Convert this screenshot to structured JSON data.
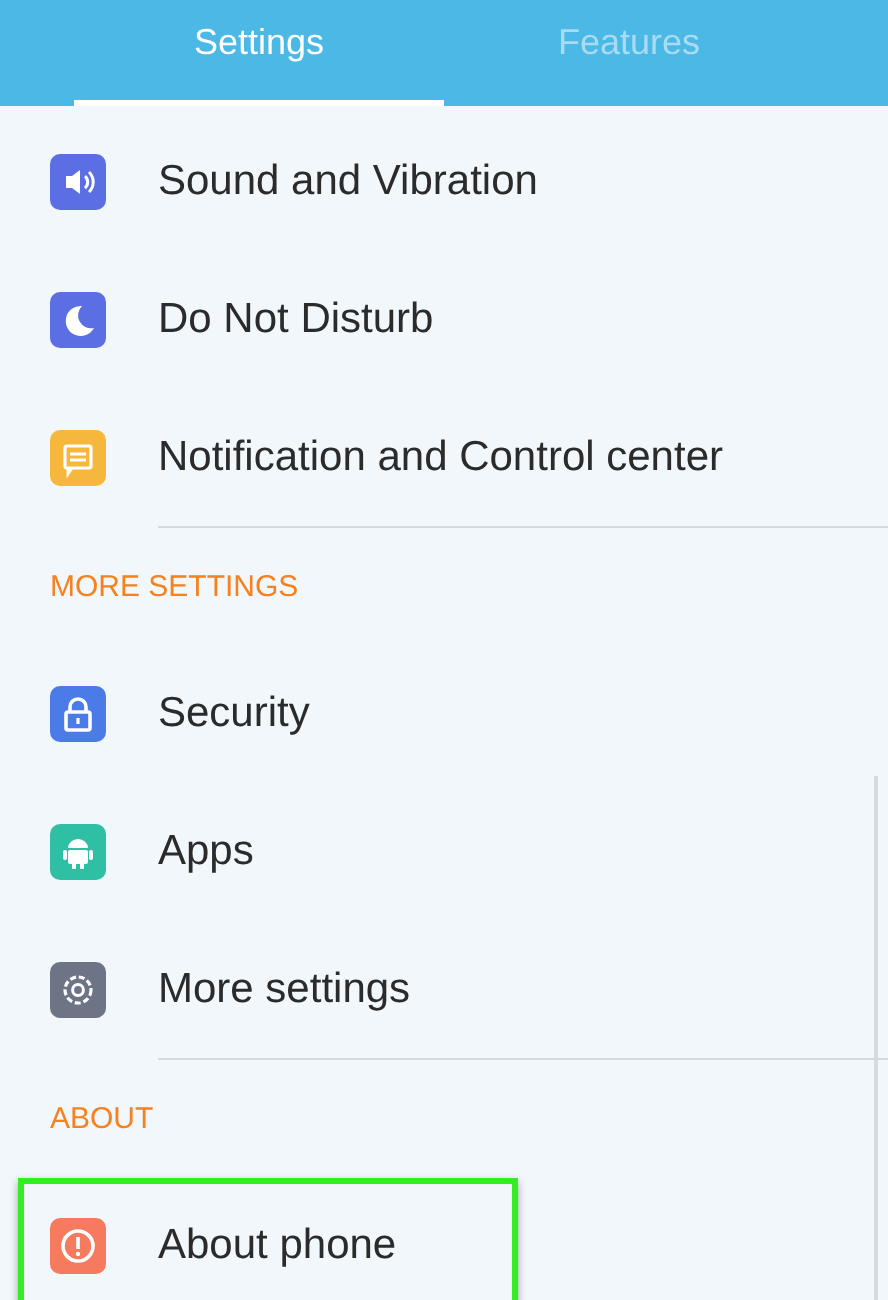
{
  "tabs": [
    {
      "label": "Settings",
      "selected": true
    },
    {
      "label": "Features",
      "selected": false
    }
  ],
  "sections": [
    {
      "items": [
        {
          "label": "Sound and Vibration",
          "color": "#5b6ee4",
          "highlighted": false
        },
        {
          "label": "Do Not Disturb",
          "color": "#5b6ee4",
          "highlighted": false
        },
        {
          "label": "Notification and Control center",
          "color": "#f6b83c",
          "highlighted": false
        }
      ]
    },
    {
      "header": "MORE SETTINGS",
      "items": [
        {
          "label": "Security",
          "color": "#4a7be6",
          "highlighted": false
        },
        {
          "label": "Apps",
          "color": "#2fbfa4",
          "highlighted": false
        },
        {
          "label": "More settings",
          "color": "#6d7485",
          "highlighted": false
        }
      ]
    },
    {
      "header": "ABOUT",
      "items": [
        {
          "label": "About phone",
          "color": "#f57a5e",
          "highlighted": true
        }
      ]
    }
  ]
}
